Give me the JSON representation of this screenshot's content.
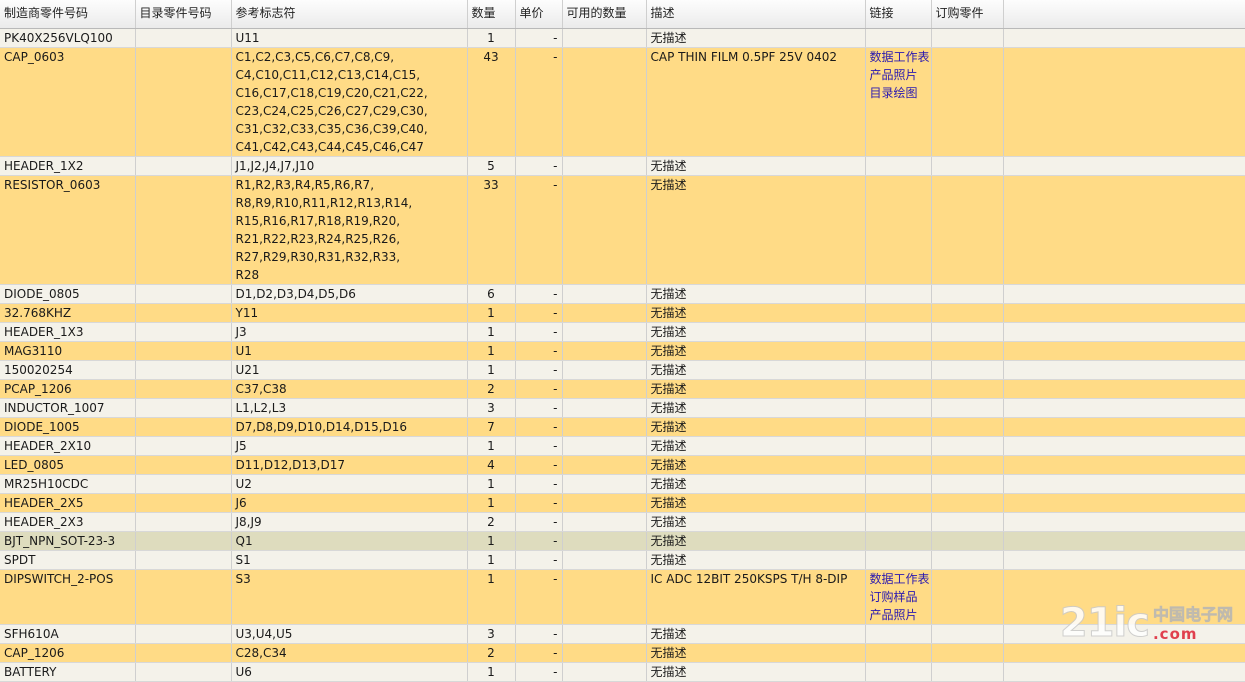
{
  "columns": [
    "制造商零件号码",
    "目录零件号码",
    "参考标志符",
    "数量",
    "单价",
    "可用的数量",
    "描述",
    "链接",
    "订购零件"
  ],
  "rows": [
    {
      "mfr": "PK40X256VLQ100",
      "cat": "",
      "ref": "U11",
      "qty": "1",
      "price": "-",
      "avail": "",
      "desc": "无描述",
      "links": []
    },
    {
      "mfr": "CAP_0603",
      "cat": "",
      "ref": "C1,C2,C3,C5,C6,C7,C8,C9,C4,C10,C11,C12,C13,C14,C15,C16,C17,C18,C19,C20,C21,C22,C23,C24,C25,C26,C27,C29,C30,C31,C32,C33,C35,C36,C39,C40,C41,C42,C43,C44,C45,C46,C47",
      "qty": "43",
      "price": "-",
      "avail": "",
      "desc": "CAP THIN FILM 0.5PF 25V 0402",
      "links": [
        "数据工作表",
        "产品照片",
        "目录绘图"
      ]
    },
    {
      "mfr": "HEADER_1X2",
      "cat": "",
      "ref": "J1,J2,J4,J7,J10",
      "qty": "5",
      "price": "-",
      "avail": "",
      "desc": "无描述",
      "links": []
    },
    {
      "mfr": "RESISTOR_0603",
      "cat": "",
      "ref": "R1,R2,R3,R4,R5,R6,R7,R8,R9,R10,R11,R12,R13,R14,R15,R16,R17,R18,R19,R20,R21,R22,R23,R24,R25,R26,R27,R29,R30,R31,R32,R33,R28",
      "qty": "33",
      "price": "-",
      "avail": "",
      "desc": "无描述",
      "links": []
    },
    {
      "mfr": "DIODE_0805",
      "cat": "",
      "ref": "D1,D2,D3,D4,D5,D6",
      "qty": "6",
      "price": "-",
      "avail": "",
      "desc": "无描述",
      "links": []
    },
    {
      "mfr": "32.768KHZ",
      "cat": "",
      "ref": "Y11",
      "qty": "1",
      "price": "-",
      "avail": "",
      "desc": "无描述",
      "links": []
    },
    {
      "mfr": "HEADER_1X3",
      "cat": "",
      "ref": "J3",
      "qty": "1",
      "price": "-",
      "avail": "",
      "desc": "无描述",
      "links": []
    },
    {
      "mfr": "MAG3110",
      "cat": "",
      "ref": "U1",
      "qty": "1",
      "price": "-",
      "avail": "",
      "desc": "无描述",
      "links": []
    },
    {
      "mfr": "150020254",
      "cat": "",
      "ref": "U21",
      "qty": "1",
      "price": "-",
      "avail": "",
      "desc": "无描述",
      "links": []
    },
    {
      "mfr": "PCAP_1206",
      "cat": "",
      "ref": "C37,C38",
      "qty": "2",
      "price": "-",
      "avail": "",
      "desc": "无描述",
      "links": []
    },
    {
      "mfr": "INDUCTOR_1007",
      "cat": "",
      "ref": "L1,L2,L3",
      "qty": "3",
      "price": "-",
      "avail": "",
      "desc": "无描述",
      "links": []
    },
    {
      "mfr": "DIODE_1005",
      "cat": "",
      "ref": "D7,D8,D9,D10,D14,D15,D16",
      "qty": "7",
      "price": "-",
      "avail": "",
      "desc": "无描述",
      "links": []
    },
    {
      "mfr": "HEADER_2X10",
      "cat": "",
      "ref": "J5",
      "qty": "1",
      "price": "-",
      "avail": "",
      "desc": "无描述",
      "links": []
    },
    {
      "mfr": "LED_0805",
      "cat": "",
      "ref": "D11,D12,D13,D17",
      "qty": "4",
      "price": "-",
      "avail": "",
      "desc": "无描述",
      "links": []
    },
    {
      "mfr": "MR25H10CDC",
      "cat": "",
      "ref": "U2",
      "qty": "1",
      "price": "-",
      "avail": "",
      "desc": "无描述",
      "links": []
    },
    {
      "mfr": "HEADER_2X5",
      "cat": "",
      "ref": "J6",
      "qty": "1",
      "price": "-",
      "avail": "",
      "desc": "无描述",
      "links": []
    },
    {
      "mfr": "HEADER_2X3",
      "cat": "",
      "ref": "J8,J9",
      "qty": "2",
      "price": "-",
      "avail": "",
      "desc": "无描述",
      "links": []
    },
    {
      "mfr": "BJT_NPN_SOT-23-3",
      "cat": "",
      "ref": "Q1",
      "qty": "1",
      "price": "-",
      "avail": "",
      "desc": "无描述",
      "links": [],
      "selected": true
    },
    {
      "mfr": "SPDT",
      "cat": "",
      "ref": "S1",
      "qty": "1",
      "price": "-",
      "avail": "",
      "desc": "无描述",
      "links": []
    },
    {
      "mfr": "DIPSWITCH_2-POS",
      "cat": "",
      "ref": "S3",
      "qty": "1",
      "price": "-",
      "avail": "",
      "desc": "IC ADC 12BIT 250KSPS T/H 8-DIP",
      "links": [
        "数据工作表",
        "订购样品",
        "产品照片"
      ]
    },
    {
      "mfr": "SFH610A",
      "cat": "",
      "ref": "U3,U4,U5",
      "qty": "3",
      "price": "-",
      "avail": "",
      "desc": "无描述",
      "links": []
    },
    {
      "mfr": "CAP_1206",
      "cat": "",
      "ref": "C28,C34",
      "qty": "2",
      "price": "-",
      "avail": "",
      "desc": "无描述",
      "links": []
    },
    {
      "mfr": "BATTERY",
      "cat": "",
      "ref": "U6",
      "qty": "1",
      "price": "-",
      "avail": "",
      "desc": "无描述",
      "links": []
    }
  ],
  "watermark": {
    "logo": "21ic",
    "cn": "中国电子网",
    "domain": ".com"
  }
}
